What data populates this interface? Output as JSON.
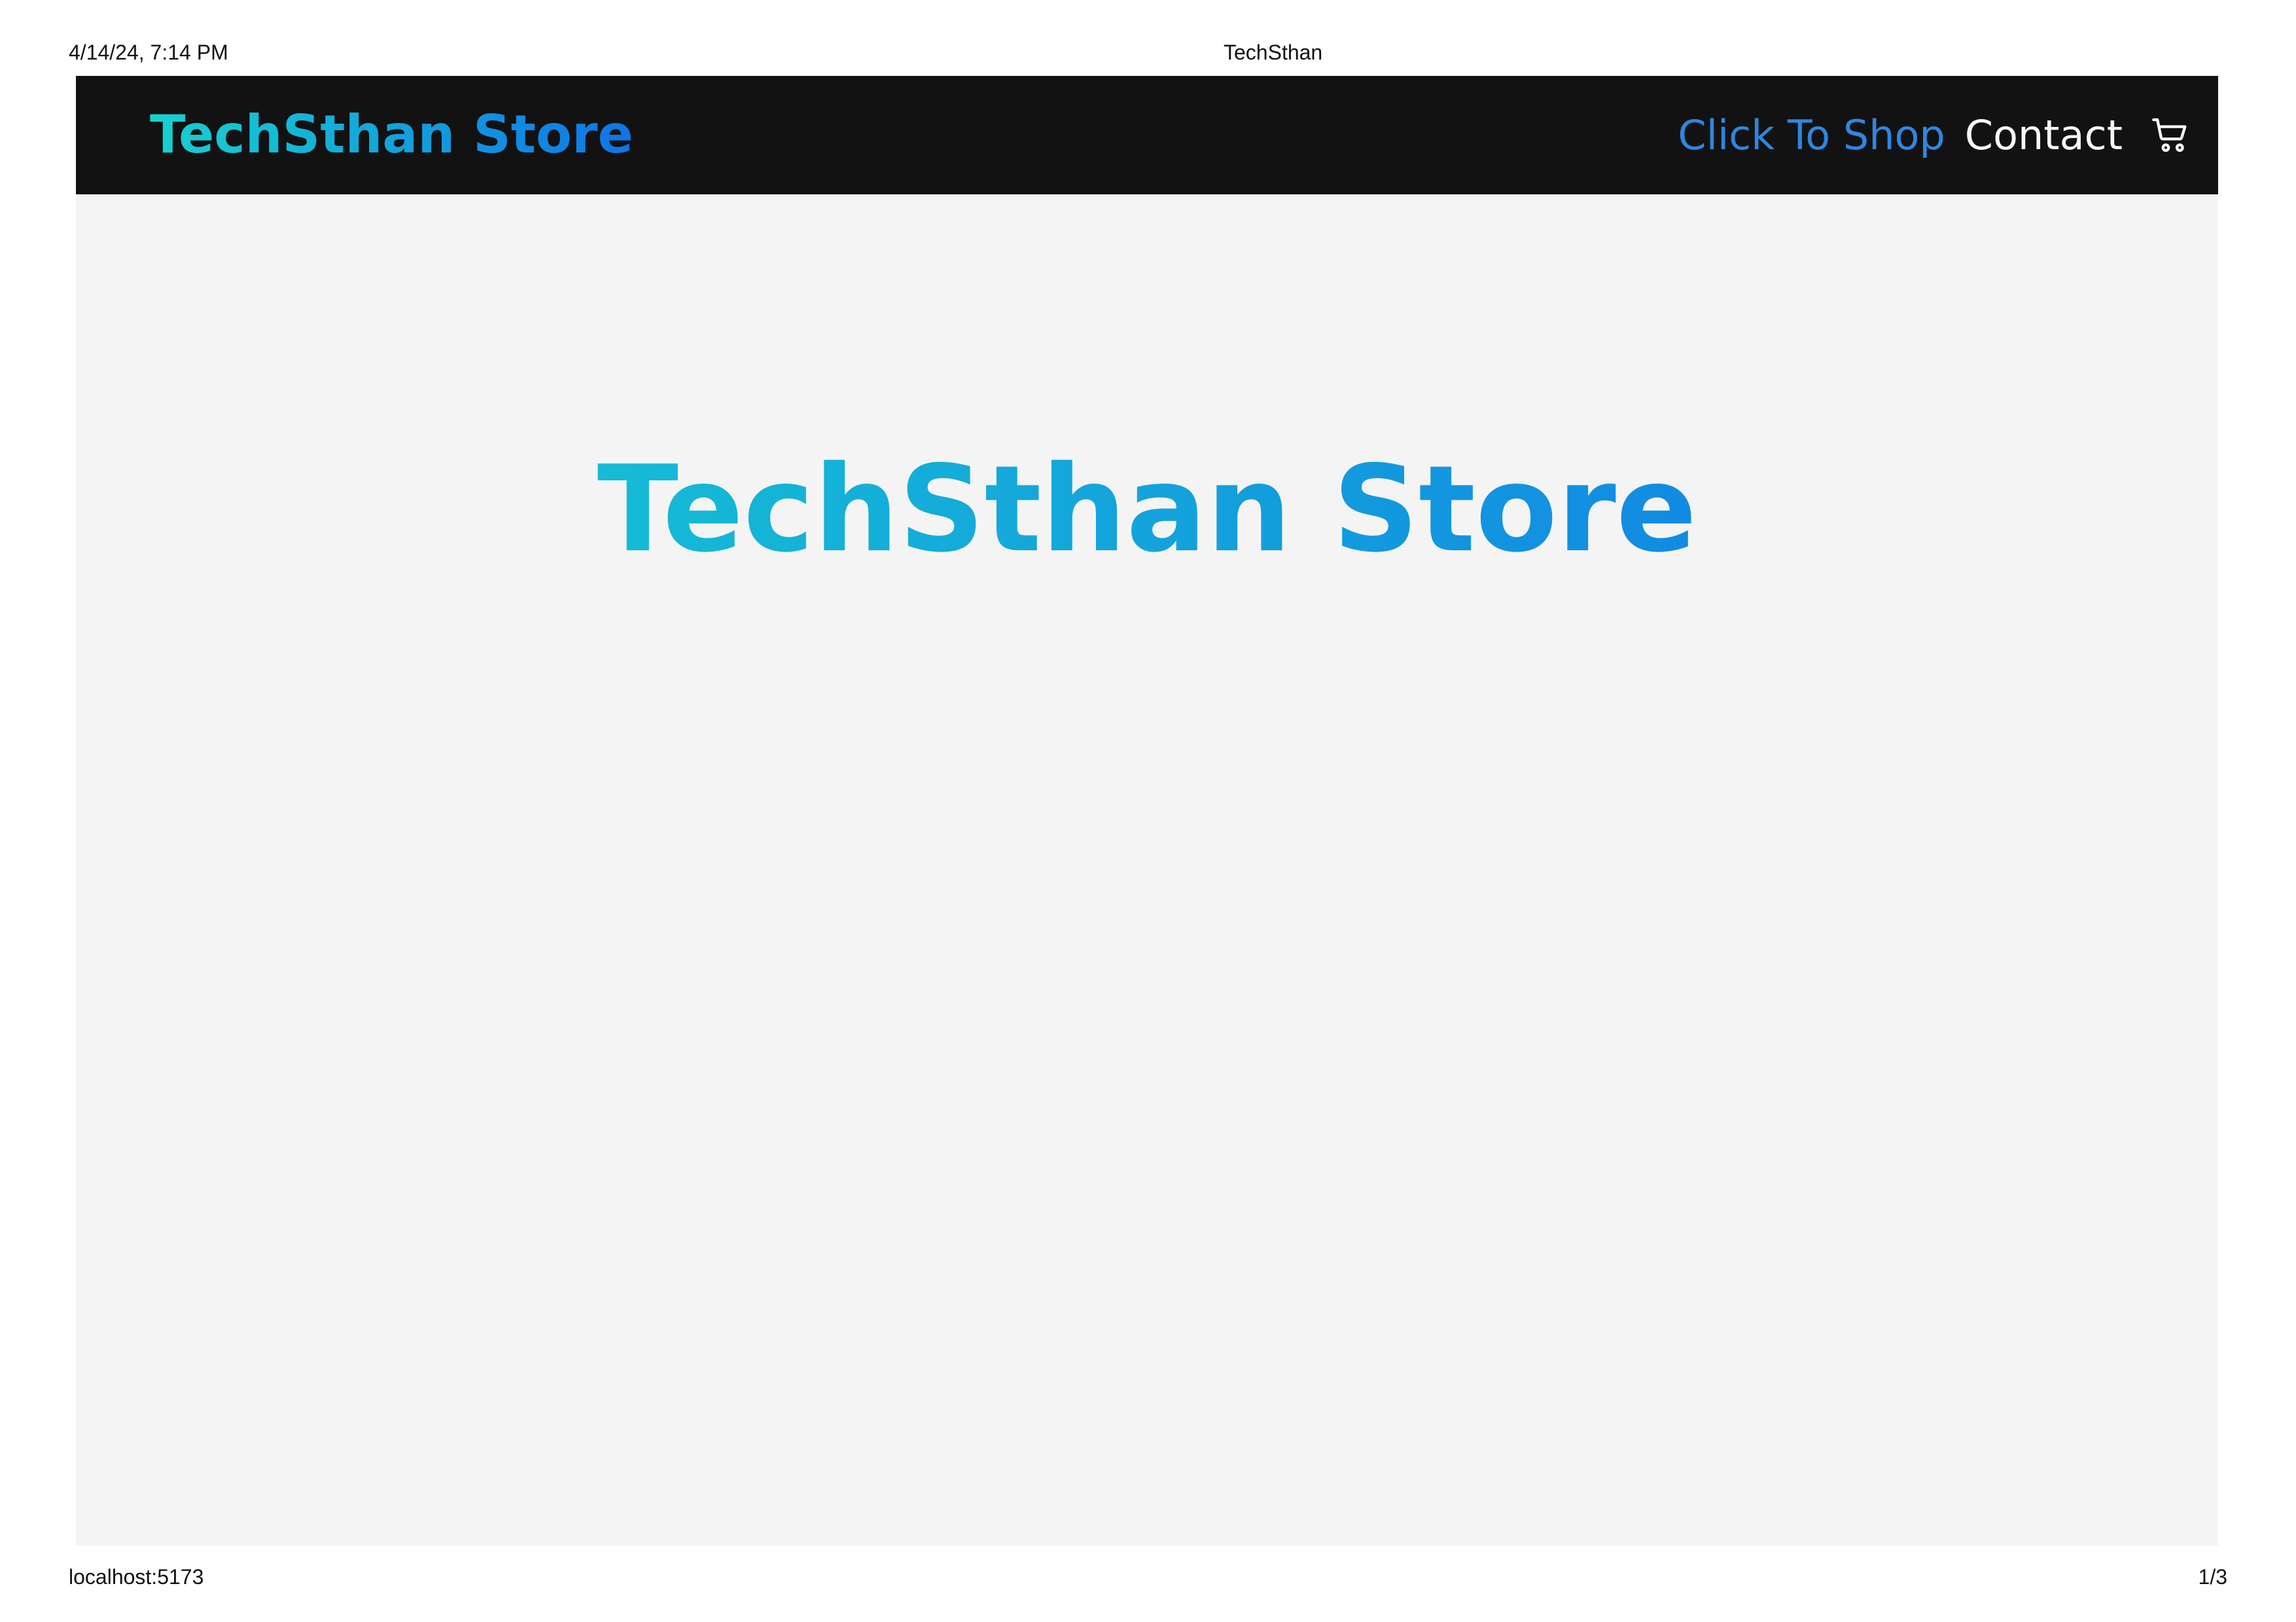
{
  "print": {
    "date_time": "4/14/24, 7:14 PM",
    "document_title": "TechSthan",
    "url": "localhost:5173",
    "page_number": "1/3"
  },
  "navbar": {
    "brand": "TechSthan Store",
    "links": {
      "shop": "Click To Shop",
      "contact": "Contact"
    },
    "icons": {
      "cart": "cart-icon"
    }
  },
  "hero": {
    "title": "TechSthan Store"
  },
  "colors": {
    "navbar_background": "#121212",
    "page_background": "#f4f4f4",
    "accent_start": "#17d2cf",
    "accent_end": "#0f74e8",
    "shop_link": "#2f86e0",
    "contact_link": "#f7f7f7"
  }
}
